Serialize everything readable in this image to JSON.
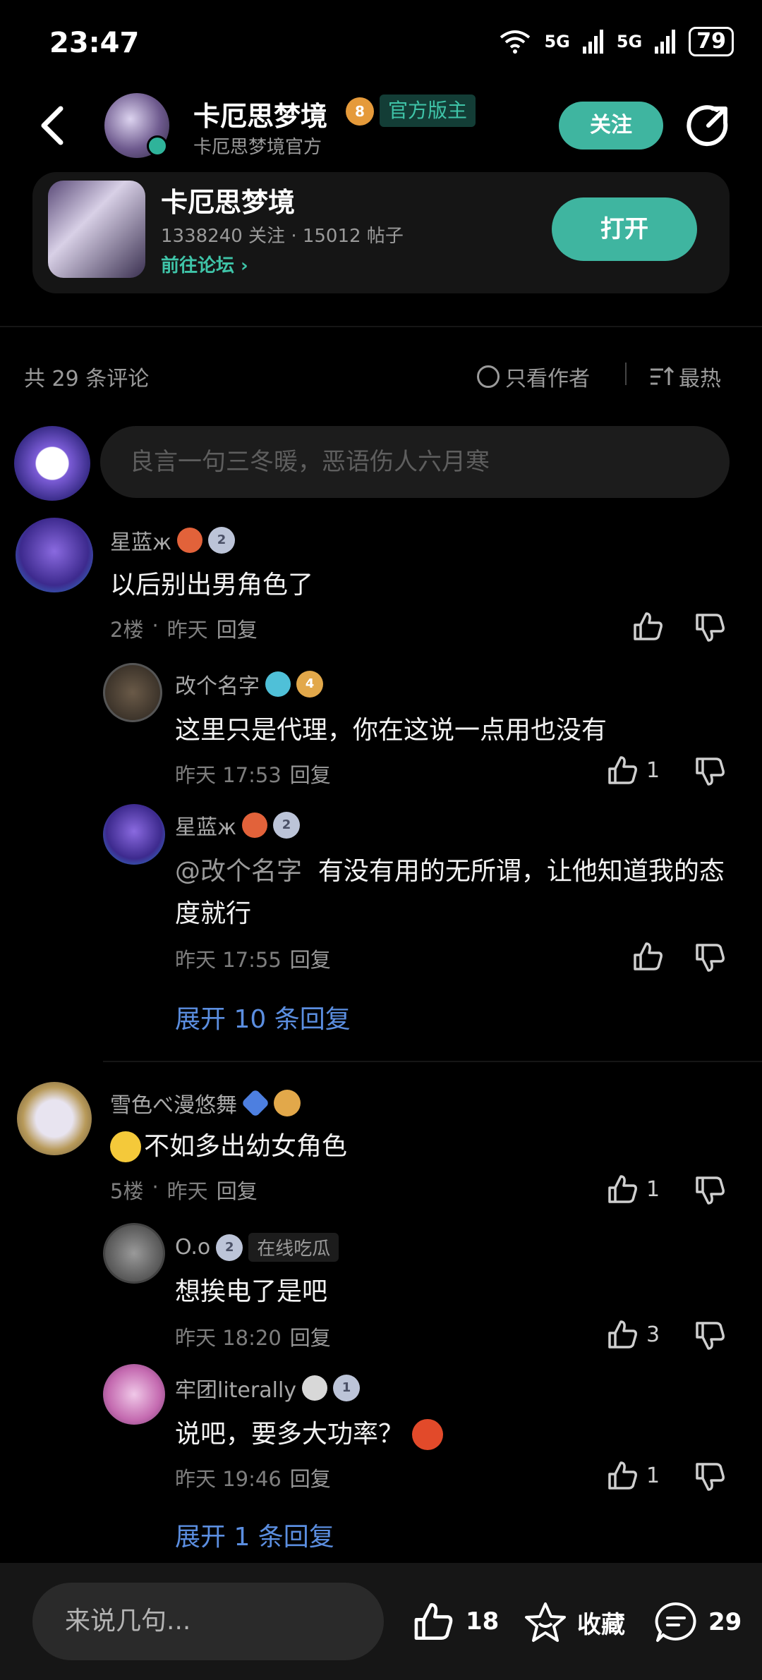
{
  "status_bar": {
    "time": "23:47",
    "battery": "79",
    "signal1": "5G",
    "signal2": "5G"
  },
  "header": {
    "name": "卡厄思梦境",
    "level": "8",
    "official_badge": "官方版主",
    "subtitle": "卡厄思梦境官方",
    "follow_label": "关注"
  },
  "forum_card": {
    "title": "卡厄思梦境",
    "stats": "1338240 关注 · 15012 帖子",
    "link": "前往论坛 ›",
    "open_label": "打开"
  },
  "comments_bar": {
    "count": "共 29 条评论",
    "only_author": "只看作者",
    "sort": "最热"
  },
  "my_input": {
    "placeholder": "良言一句三冬暖，恶语伤人六月寒"
  },
  "threads": [
    {
      "user": "星蓝ж",
      "badge_level": "2",
      "text": "以后别出男角色了",
      "floor": "2楼",
      "time": "昨天",
      "reply": "回复",
      "likes": "",
      "replies": [
        {
          "user": "改个名字",
          "badge_level": "4",
          "text": "这里只是代理，你在这说一点用也没有",
          "time": "昨天 17:53",
          "reply": "回复",
          "likes": "1"
        },
        {
          "user": "星蓝ж",
          "badge_level": "2",
          "mention": "@改个名字",
          "text": "有没有用的无所谓，让他知道我的态度就行",
          "time": "昨天 17:55",
          "reply": "回复",
          "likes": ""
        }
      ],
      "expand": "展开 10 条回复"
    },
    {
      "user": "雪色べ漫悠舞",
      "badge_level": "",
      "text": "不如多出幼女角色",
      "floor": "5楼",
      "time": "昨天",
      "reply": "回复",
      "likes": "1",
      "replies": [
        {
          "user": "O.o",
          "badge_level": "2",
          "tag": "在线吃瓜",
          "text": "想挨电了是吧",
          "time": "昨天 18:20",
          "reply": "回复",
          "likes": "3"
        },
        {
          "user": "牢团literally",
          "badge_level": "1",
          "text": "说吧，要多大功率？",
          "time": "昨天 19:46",
          "reply": "回复",
          "likes": "1"
        }
      ],
      "expand": "展开 1 条回复"
    }
  ],
  "bottom_bar": {
    "placeholder": "来说几句...",
    "likes": "18",
    "favorite": "收藏",
    "comments": "29"
  },
  "colors": {
    "accent": "#3fb5a0",
    "link": "#5b8ee0",
    "background": "#000000"
  }
}
